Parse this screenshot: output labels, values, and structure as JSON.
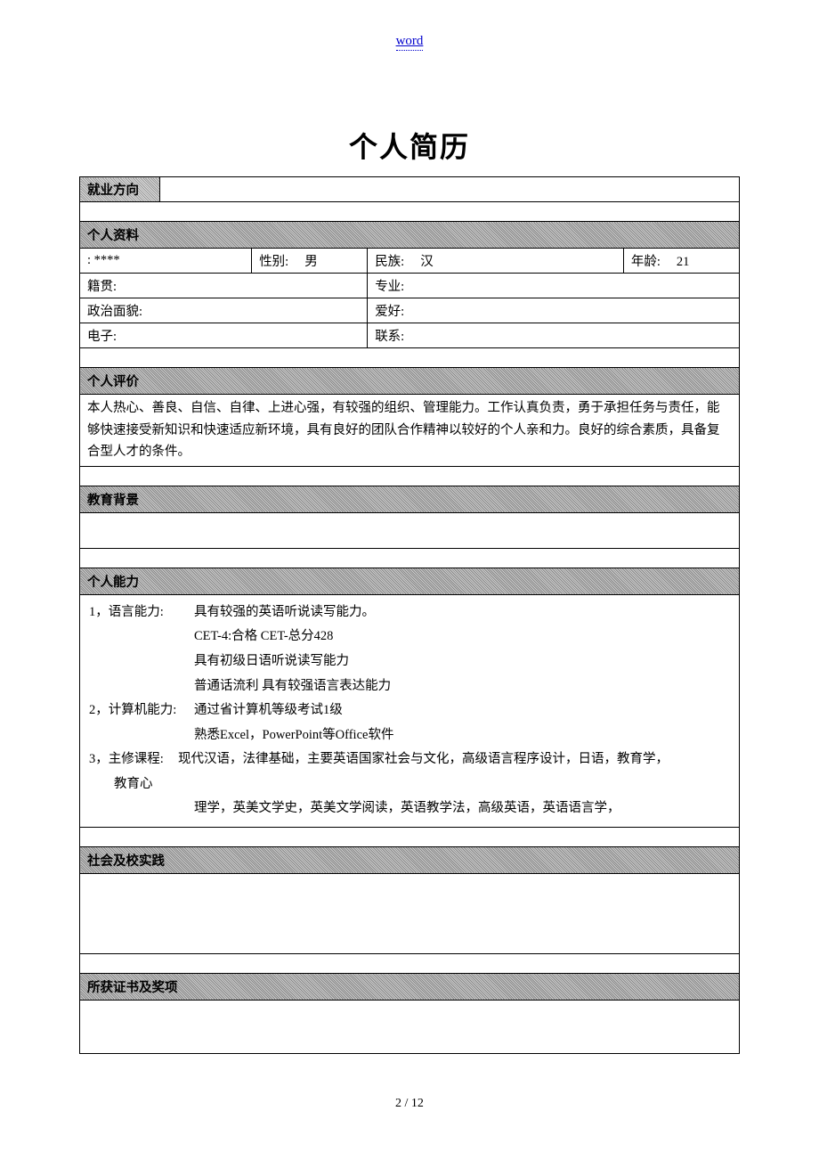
{
  "header": {
    "link_text": "word"
  },
  "title": "个人简历",
  "sections": {
    "direction": {
      "label": "就业方向"
    },
    "personal_info": {
      "header": "个人资料",
      "name_prefix": ": ",
      "name_value": "****",
      "gender_label": "性别:",
      "gender_value": "男",
      "ethnic_label": "民族:",
      "ethnic_value": "汉",
      "age_label": "年龄:",
      "age_value": "21",
      "origin_label": "籍贯:",
      "major_label": "专业:",
      "political_label": "政治面貌:",
      "hobby_label": "爱好:",
      "email_label": "电子:",
      "contact_label": "联系:"
    },
    "self_eval": {
      "header": "个人评价",
      "content": "本人热心、善良、自信、自律、上进心强，有较强的组织、管理能力。工作认真负责，勇于承担任务与责任，能够快速接受新知识和快速适应新环境，具有良好的团队合作精神以较好的个人亲和力。良好的综合素质，具备复合型人才的条件。"
    },
    "education": {
      "header": "教育背景"
    },
    "ability": {
      "header": "个人能力",
      "item1_label": "1，语言能力:",
      "item1_line1": "具有较强的英语听说读写能力。",
      "item1_line2": "CET-4:合格   CET-总分428",
      "item1_line3": "具有初级日语听说读写能力",
      "item1_line4": "普通话流利 具有较强语言表达能力",
      "item2_label": "2，计算机能力:",
      "item2_line1": "通过省计算机等级考试1级",
      "item2_line2": "熟悉Excel，PowerPoint等Office软件",
      "item3_label": "3，主修课程:",
      "item3_line1": "现代汉语，法律基础，主要英语国家社会与文化，高级语言程序设计，日语，教育学，",
      "item3_sublabel": "教育心",
      "item3_line2": "理学，英美文学史，英美文学阅读，英语教学法，高级英语，英语语言学，"
    },
    "practice": {
      "header": "社会及校实践"
    },
    "awards": {
      "header": "所获证书及奖项"
    }
  },
  "footer": {
    "page_number": "2 / 12"
  }
}
